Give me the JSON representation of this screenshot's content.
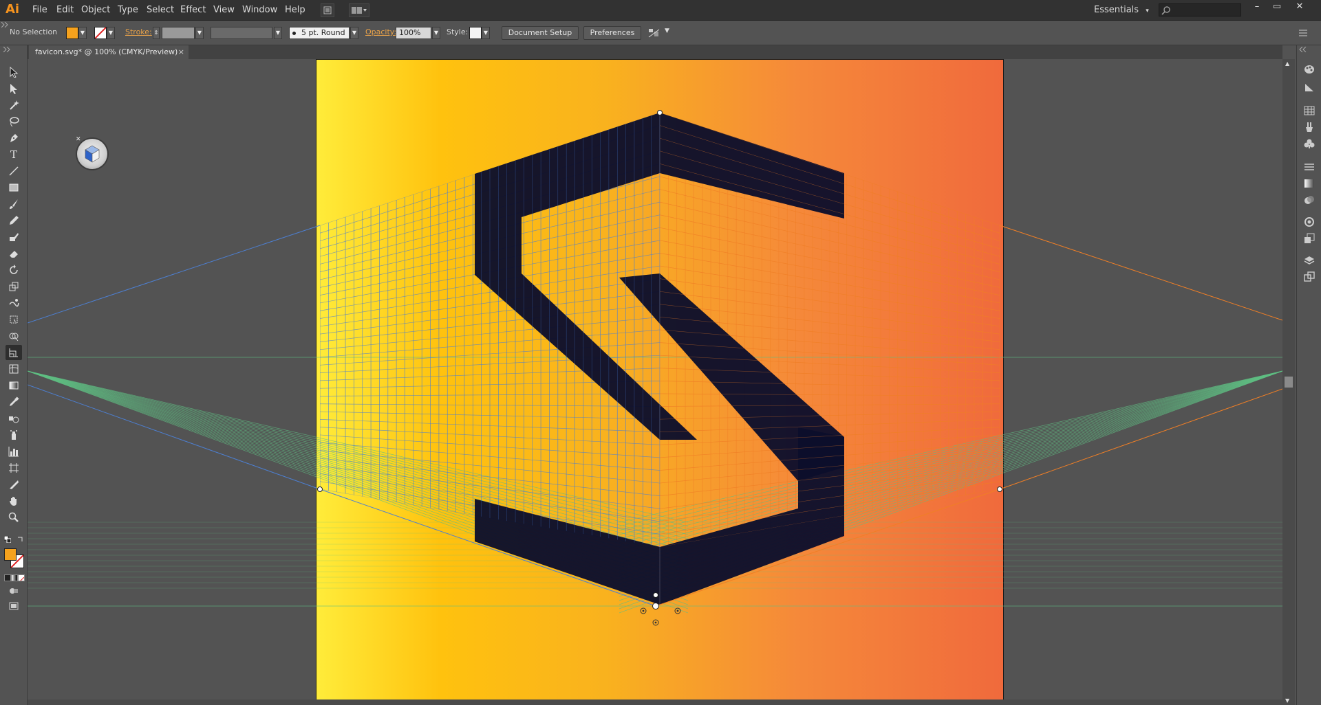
{
  "app": {
    "logo": "Ai",
    "brand_color": "#f7941e"
  },
  "menus": [
    "File",
    "Edit",
    "Object",
    "Type",
    "Select",
    "Effect",
    "View",
    "Window",
    "Help"
  ],
  "workspace": {
    "label": "Essentials",
    "caret": "▾"
  },
  "search": {
    "placeholder": ""
  },
  "window_controls": {
    "minimize": "–",
    "restore": "▭",
    "close": "✕"
  },
  "control_bar": {
    "selection": "No Selection",
    "fill_color": "#f6a21d",
    "stroke_label": "Stroke:",
    "stroke_weight": "",
    "variable_width": "",
    "brush": "5 pt. Round",
    "opacity_label": "Opacity:",
    "opacity_value": "100%",
    "style_label": "Style:",
    "document_setup": "Document Setup",
    "preferences": "Preferences"
  },
  "document": {
    "tab_title": "favicon.svg* @ 100% (CMYK/Preview)",
    "close": "×"
  },
  "tools": [
    "selection-tool",
    "direct-selection-tool",
    "magic-wand-tool",
    "lasso-tool",
    "pen-tool",
    "type-tool",
    "line-segment-tool",
    "rectangle-tool",
    "paintbrush-tool",
    "pencil-tool",
    "blob-brush-tool",
    "eraser-tool",
    "rotate-tool",
    "scale-tool",
    "warp-tool",
    "free-transform-tool",
    "shape-builder-tool",
    "perspective-grid-tool",
    "mesh-tool",
    "gradient-tool",
    "eyedropper-tool",
    "blend-tool",
    "symbol-sprayer-tool",
    "column-graph-tool",
    "artboard-tool",
    "slice-tool",
    "hand-tool",
    "zoom-tool"
  ],
  "panels": [
    "color-panel",
    "color-guide-panel",
    "swatches-panel",
    "brushes-panel",
    "symbols-panel",
    "stroke-panel",
    "gradient-panel",
    "transparency-panel",
    "appearance-panel",
    "graphic-styles-panel",
    "layers-panel",
    "artboards-panel"
  ],
  "colors": {
    "grid_left": "#4d7fd1",
    "grid_right": "#f07f26",
    "grid_ground": "#5fbf83",
    "letter": "#0c0f2c",
    "artboard_gradient": [
      "#ffec3a",
      "#ffc20e",
      "#f5893a",
      "#f06a3c"
    ]
  }
}
